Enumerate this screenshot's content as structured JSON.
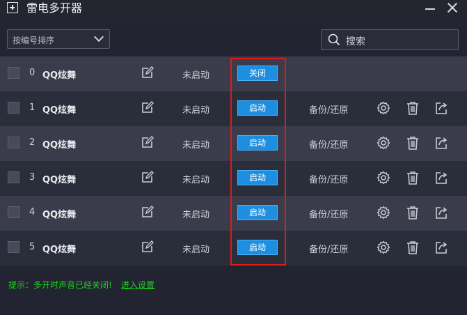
{
  "app": {
    "title": "雷电多开器"
  },
  "toolbar": {
    "sort_label": "按编号排序",
    "search_placeholder": "搜索"
  },
  "rows": [
    {
      "index": "0",
      "name": "QQ炫舞",
      "status": "未启动",
      "action": "关闭",
      "backup": ""
    },
    {
      "index": "1",
      "name": "QQ炫舞",
      "status": "未启动",
      "action": "启动",
      "backup": "备份/还原"
    },
    {
      "index": "2",
      "name": "QQ炫舞",
      "status": "未启动",
      "action": "启动",
      "backup": "备份/还原"
    },
    {
      "index": "3",
      "name": "QQ炫舞",
      "status": "未启动",
      "action": "启动",
      "backup": "备份/还原"
    },
    {
      "index": "4",
      "name": "QQ炫舞",
      "status": "未启动",
      "action": "启动",
      "backup": "备份/还原"
    },
    {
      "index": "5",
      "name": "QQ炫舞",
      "status": "未启动",
      "action": "启动",
      "backup": "备份/还原"
    }
  ],
  "footer": {
    "tip": "提示：多开时声音已经关闭!",
    "link": "进入设置"
  },
  "colors": {
    "accent": "#1e8fe0",
    "highlight": "#e01a1a",
    "tip": "#18d418",
    "background": "#222531"
  }
}
